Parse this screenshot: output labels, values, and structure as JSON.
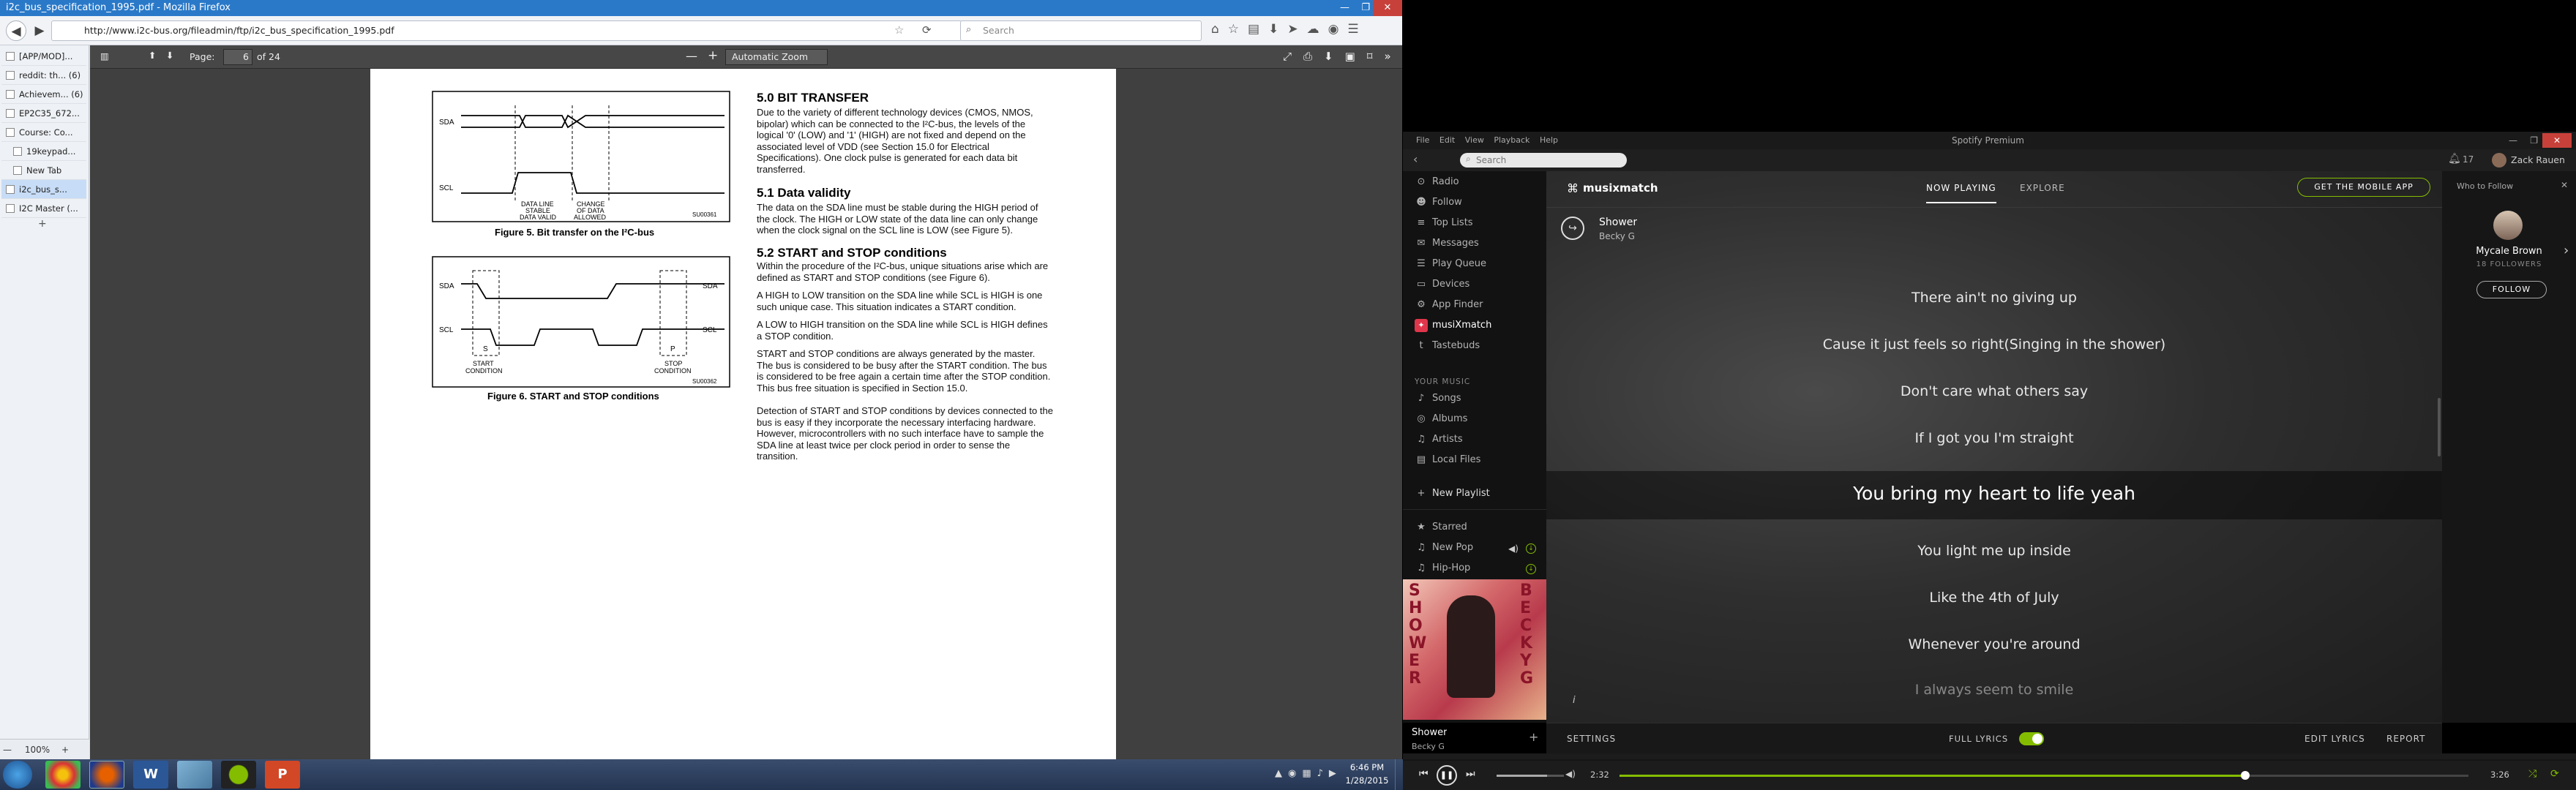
{
  "firefox": {
    "title": "i2c_bus_specification_1995.pdf - Mozilla Firefox",
    "url": "http://www.i2c-bus.org/fileadmin/ftp/i2c_bus_specification_1995.pdf",
    "search_placeholder": "Search",
    "tabs": [
      {
        "label": "[APP/MOD]..."
      },
      {
        "label": "reddit: th... (6)"
      },
      {
        "label": "Achievem... (6)"
      },
      {
        "label": "EP2C35_672..."
      },
      {
        "label": "Course: Co..."
      },
      {
        "label": "19keypad..."
      },
      {
        "label": "New Tab"
      },
      {
        "label": "i2c_bus_s..."
      },
      {
        "label": "I2C Master (..."
      }
    ],
    "zoom_label": "100%"
  },
  "pdf": {
    "page_label": "Page:",
    "page_number": "6",
    "page_total": "of 24",
    "zoom": "Automatic Zoom",
    "fig5": {
      "caption": "Figure 5.    Bit transfer on the I²C-bus",
      "sda": "SDA",
      "scl": "SCL",
      "label1": "DATA LINE\nSTABLE\nDATA VALID",
      "label2": "CHANGE\nOF DATA\nALLOWED",
      "code": "SU00361"
    },
    "fig6": {
      "caption": "Figure 6.    START and STOP conditions",
      "sda": "SDA",
      "scl": "SCL",
      "s": "S",
      "p": "P",
      "start": "START\nCONDITION",
      "stop": "STOP\nCONDITION",
      "code": "SU00362"
    },
    "h50": "5.0     BIT TRANSFER",
    "p50": "Due to the variety of different technology devices (CMOS, NMOS, bipolar) which can be connected to the I²C-bus, the levels of the logical '0' (LOW) and '1' (HIGH) are not fixed and depend on the associated level of VDD (see Section  15.0 for Electrical Specifications). One clock pulse is generated for each data bit transferred.",
    "h51": "5.1     Data validity",
    "p51": "The data on the SDA line must be stable during the HIGH period of the clock. The HIGH or LOW state of the data line can only change when the clock signal on the SCL line is LOW (see Figure 5).",
    "h52": "5.2     START and STOP conditions",
    "p52a": "Within the procedure of the I²C-bus, unique situations arise which are defined as START and STOP conditions (see Figure 6).",
    "p52b": "A HIGH to LOW transition on the SDA line while SCL is HIGH is one such unique case. This situation indicates a START condition.",
    "p52c": "A LOW to HIGH transition on the SDA line while SCL is HIGH defines a STOP condition.",
    "p52d": "START and STOP conditions are always generated by the master. The bus is considered to be busy after the START condition. The bus is considered to be free again a certain time after the STOP condition. This bus free situation is specified in Section 15.0.",
    "p52e": "Detection of START and STOP conditions by devices connected to the bus is easy if they incorporate the necessary interfacing hardware. However, microcontrollers with no such interface have to sample the SDA line at least twice per clock period in order to sense the transition."
  },
  "spotify": {
    "title": "Spotify Premium",
    "menu": [
      "File",
      "Edit",
      "View",
      "Playback",
      "Help"
    ],
    "search_placeholder": "Search",
    "notifications": "17",
    "user": "Zack Rauen",
    "sidebar": {
      "items": [
        "Radio",
        "Follow",
        "Top Lists",
        "Messages",
        "Play Queue",
        "Devices",
        "App Finder",
        "musiXmatch",
        "Tastebuds"
      ],
      "your_music_header": "YOUR MUSIC",
      "your_music": [
        "Songs",
        "Albums",
        "Artists",
        "Local Files"
      ],
      "new_playlist": "New Playlist",
      "playlists": [
        "Starred",
        "New Pop",
        "Hip-Hop"
      ]
    },
    "now_playing": {
      "track": "Shower",
      "artist": "Becky G",
      "art_text_left": "SHOWER",
      "art_text_right": "BECKY G"
    },
    "app": {
      "brand": "musixmatch",
      "tab_now_playing": "NOW PLAYING",
      "tab_explore": "EXPLORE",
      "get_app": "GET THE MOBILE APP",
      "track": "Shower",
      "artist": "Becky G",
      "lyrics": [
        "There ain't no giving up",
        "Cause it just feels so right(Singing in the shower)",
        "Don't care what others say",
        "If I got you I'm straight",
        "You bring my heart to life yeah",
        "You light me up inside",
        "Like the 4th of July",
        "Whenever you're around",
        "I always seem to smile"
      ],
      "settings": "SETTINGS",
      "full_lyrics": "FULL LYRICS",
      "edit_lyrics": "EDIT LYRICS",
      "report": "REPORT",
      "info": "i"
    },
    "follow_panel": {
      "header": "Who to Follow",
      "name": "Mycale Brown",
      "followers": "18 FOLLOWERS",
      "button": "FOLLOW"
    },
    "player": {
      "elapsed": "2:32",
      "total": "3:26",
      "progress": 0.737,
      "volume": 0.75
    }
  },
  "taskbar": {
    "time": "6:46 PM",
    "date": "1/28/2015"
  },
  "colors": {
    "spotify_green": "#84bd00",
    "firefox_blue": "#2a79c9",
    "taskbar": "#2b3d5e"
  }
}
